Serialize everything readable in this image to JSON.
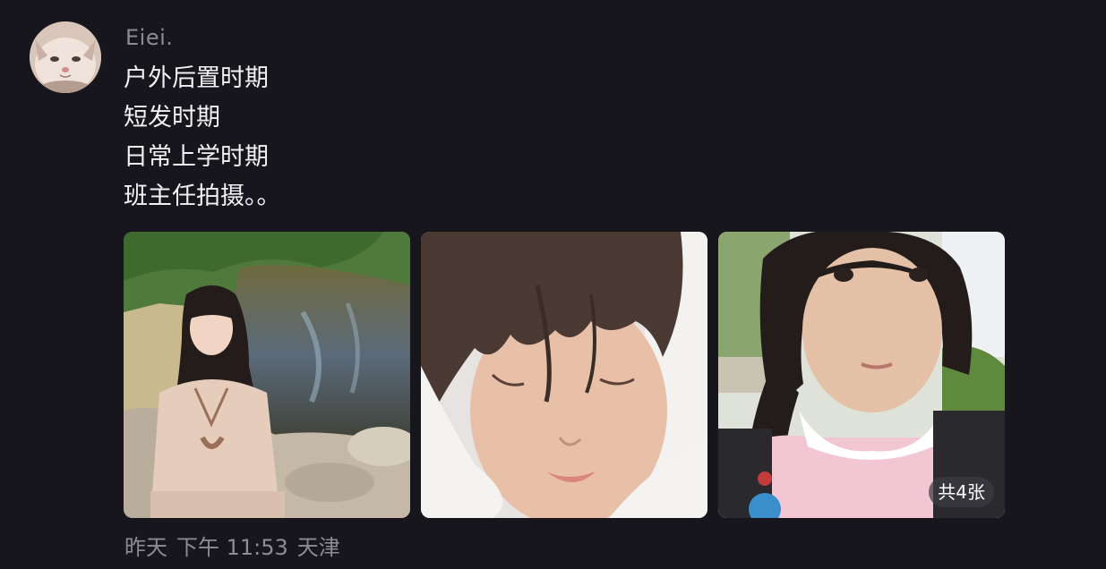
{
  "post": {
    "username": "Eiei.",
    "text_lines": [
      "户外后置时期",
      "短发时期",
      "日常上学时期",
      "班主任拍摄。。"
    ],
    "photos": [
      {
        "icon": "photo-outdoor-girl-by-pond"
      },
      {
        "icon": "photo-short-hair-selfie"
      },
      {
        "icon": "photo-school-uniform-portrait"
      }
    ],
    "photo_count_badge": "共4张",
    "meta": {
      "day": "昨天",
      "time": "下午 11:53",
      "location": "天津"
    }
  },
  "colors": {
    "background": "#17161c",
    "primary_text": "#f2f2f4",
    "secondary_text": "#8d8b95"
  }
}
